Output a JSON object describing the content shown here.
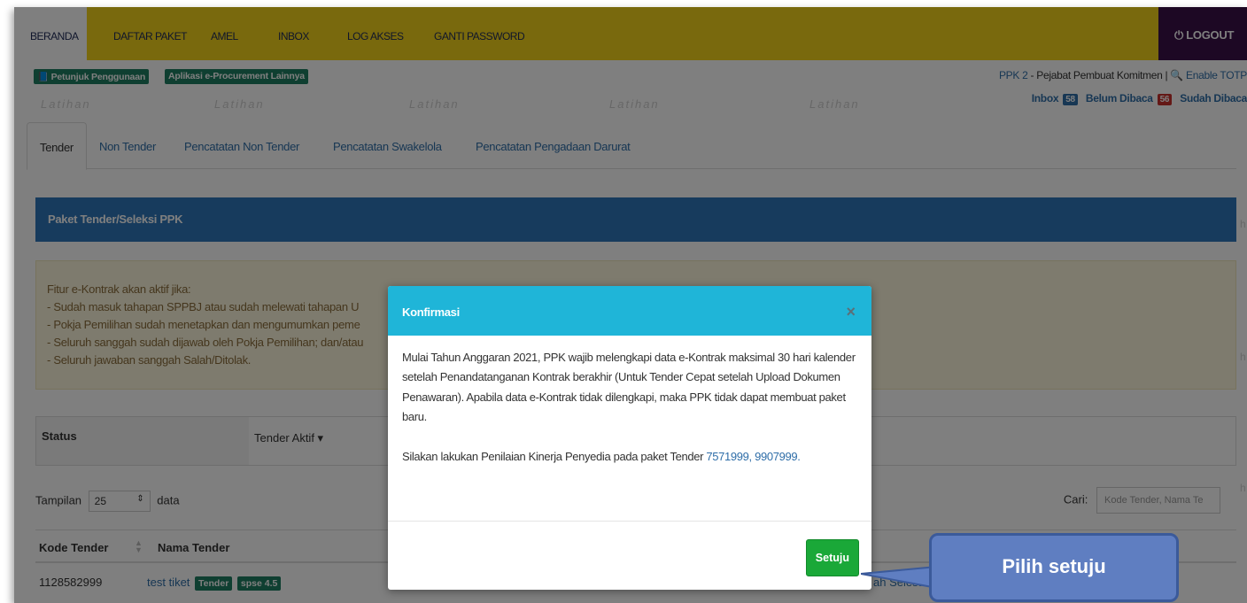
{
  "nav": {
    "items": [
      "BERANDA",
      "DAFTAR PAKET",
      "AMEL",
      "INBOX",
      "LOG AKSES",
      "GANTI PASSWORD"
    ],
    "logout": "⏻ LOGOUT"
  },
  "subbar": {
    "guide": "📘 Petunjuk Penggunaan",
    "apps": "Aplikasi e-Procurement Lainnya",
    "user_prefix": "PPK 2",
    "user_role": " - Pejabat Pembuat Komitmen | ",
    "totp": "🔍 Enable TOTP",
    "inbox_label": "Inbox",
    "inbox_count": "58",
    "unread_label": "Belum Dibaca",
    "unread_count": "56",
    "read_label": "Sudah Dibaca",
    "watermark": "Latihan"
  },
  "tabs": [
    "Tender",
    "Non Tender",
    "Pencatatan Non Tender",
    "Pencatatan Swakelola",
    "Pencatatan Pengadaan Darurat"
  ],
  "panel_title": "Paket Tender/Seleksi PPK",
  "alert_lines": [
    "Fitur e-Kontrak akan aktif jika:",
    "- Sudah masuk tahapan SPPBJ atau sudah melewati tahapan U",
    "- Pokja Pemilihan sudah menetapkan dan mengumumkan peme",
    "- Seluruh sanggah sudah dijawab oleh Pokja Pemilihan; dan/atau",
    "- Seluruh jawaban sanggah Salah/Ditolak."
  ],
  "status": {
    "label": "Status",
    "value": "Tender Aktif  ▾"
  },
  "tampilan": {
    "prefix": "Tampilan",
    "value": "25",
    "suffix": "data"
  },
  "search": {
    "label": "Cari:",
    "placeholder": "Kode Tender, Nama Te"
  },
  "table": {
    "headers": [
      "Kode Tender",
      "Nama Tender"
    ],
    "row": {
      "kode": "1128582999",
      "nama": "test tiket",
      "tag1": "Tender",
      "tag2": "spse 4.5",
      "status_partial": "ah Selesai"
    }
  },
  "modal": {
    "title": "Konfirmasi",
    "close": "×",
    "p1": "Mulai Tahun Anggaran 2021, PPK wajib melengkapi data e-Kontrak maksimal 30 hari kalender setelah Penandatanganan Kontrak berakhir (Untuk Tender Cepat setelah Upload Dokumen Penawaran). Apabila data e-Kontrak tidak dilengkapi, maka PPK tidak dapat membuat paket baru.",
    "p2_prefix": "Silakan lakukan Penilaian Kinerja Penyedia pada paket Tender ",
    "p2_links": "7571999, 9907999.",
    "button": "Setuju"
  },
  "callout": "Pilih setuju",
  "colors": {
    "nav_bg": "#f2d31b",
    "logout_bg": "#3a1148",
    "panel_head": "#2f77bb",
    "modal_head": "#1fb5d8",
    "button": "#1aa838",
    "callout": "#5f7ec1"
  }
}
